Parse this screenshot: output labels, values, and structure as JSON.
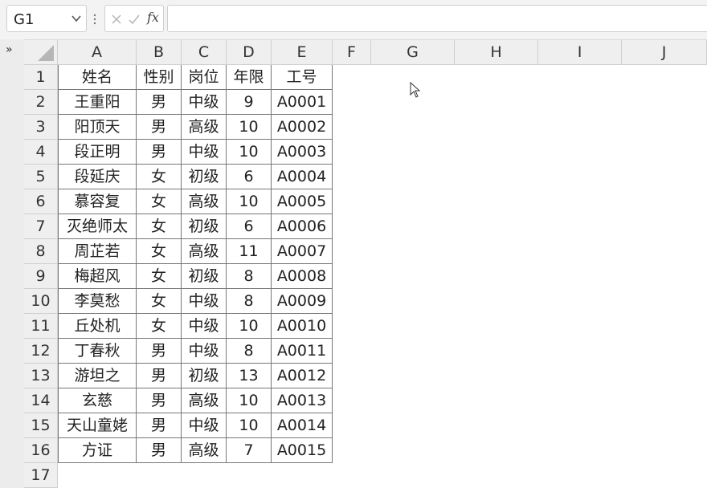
{
  "formula_bar": {
    "name_box": "G1",
    "fx_label": "fx",
    "formula": ""
  },
  "columns": [
    "A",
    "B",
    "C",
    "D",
    "E",
    "F",
    "G",
    "H",
    "I",
    "J"
  ],
  "rows": [
    "1",
    "2",
    "3",
    "4",
    "5",
    "6",
    "7",
    "8",
    "9",
    "10",
    "11",
    "12",
    "13",
    "14",
    "15",
    "16",
    "17"
  ],
  "table": {
    "header": [
      "姓名",
      "性别",
      "岗位",
      "年限",
      "工号"
    ],
    "records": [
      [
        "王重阳",
        "男",
        "中级",
        "9",
        "A0001"
      ],
      [
        "阳顶天",
        "男",
        "高级",
        "10",
        "A0002"
      ],
      [
        "段正明",
        "男",
        "中级",
        "10",
        "A0003"
      ],
      [
        "段延庆",
        "女",
        "初级",
        "6",
        "A0004"
      ],
      [
        "慕容复",
        "女",
        "高级",
        "10",
        "A0005"
      ],
      [
        "灭绝师太",
        "女",
        "初级",
        "6",
        "A0006"
      ],
      [
        "周芷若",
        "女",
        "高级",
        "11",
        "A0007"
      ],
      [
        "梅超风",
        "女",
        "初级",
        "8",
        "A0008"
      ],
      [
        "李莫愁",
        "女",
        "中级",
        "8",
        "A0009"
      ],
      [
        "丘处机",
        "女",
        "中级",
        "10",
        "A0010"
      ],
      [
        "丁春秋",
        "男",
        "中级",
        "8",
        "A0011"
      ],
      [
        "游坦之",
        "男",
        "初级",
        "13",
        "A0012"
      ],
      [
        "玄慈",
        "男",
        "高级",
        "10",
        "A0013"
      ],
      [
        "天山童姥",
        "男",
        "中级",
        "10",
        "A0014"
      ],
      [
        "方证",
        "男",
        "高级",
        "7",
        "A0015"
      ]
    ]
  },
  "icons": {
    "name_box_dropdown": "chevron-down-icon",
    "cancel": "cancel-icon",
    "enter": "check-icon",
    "sidebar_toggle": "double-chevron-right-icon",
    "mouse": "mouse-pointer-icon"
  }
}
